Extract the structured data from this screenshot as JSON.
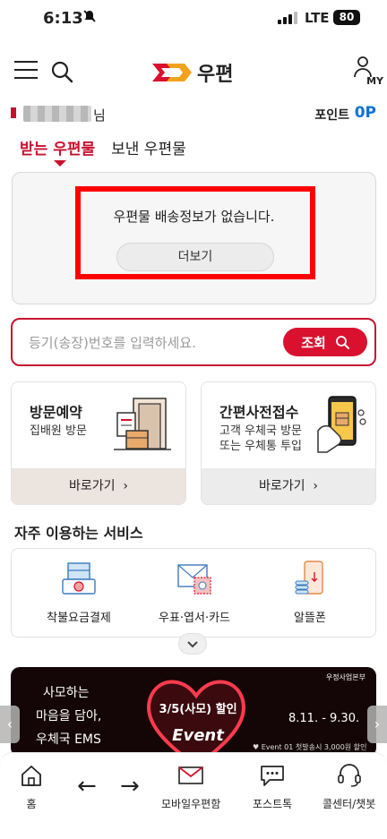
{
  "status_bar": {
    "time": "6:13",
    "network": "LTE",
    "battery": "80"
  },
  "header": {
    "logo_text": "우편",
    "my_label": "MY"
  },
  "user": {
    "name_suffix": "님",
    "point_label": "포인트",
    "point_value": "0P"
  },
  "tabs": [
    {
      "label": "받는 우편물",
      "active": true
    },
    {
      "label": "보낸 우편물",
      "active": false
    }
  ],
  "delivery": {
    "empty_text": "우편물 배송정보가 없습니다.",
    "more_label": "더보기"
  },
  "search": {
    "placeholder": "등기(송장)번호를 입력하세요.",
    "button_label": "조회"
  },
  "service_cards": [
    {
      "title": "방문예약",
      "desc": [
        "집배원 방문"
      ],
      "go_label": "바로가기",
      "go_arrow": "›"
    },
    {
      "title": "간편사전접수",
      "desc": [
        "고객 우체국 방문",
        "또는 우체통 투입"
      ],
      "go_label": "바로가기",
      "go_arrow": "›"
    }
  ],
  "frequent": {
    "title": "자주 이용하는 서비스",
    "items": [
      {
        "label": "착불요금결제",
        "icon": "cod-payment-icon"
      },
      {
        "label": "우표·엽서·카드",
        "icon": "stamp-postcard-icon"
      },
      {
        "label": "알뜰폰",
        "icon": "budget-phone-icon"
      }
    ]
  },
  "banner": {
    "line1": "사모하는",
    "line2": "마음을 담아,",
    "line3": "우체국 EMS",
    "promo": "3/5(사모) 할인",
    "event": "Event",
    "period": "8.11. - 9.30.",
    "org": "우정사업본부",
    "fine_print": "♥ Event 01 첫발송시 3,000원 할인"
  },
  "bottom_nav": {
    "home": "홈",
    "back_arrow": "←",
    "forward_arrow": "→",
    "mailbox": "모바일우편함",
    "posttalk": "포스트톡",
    "callcenter": "콜센터/챗봇"
  },
  "colors": {
    "brand_red": "#c8102e",
    "point_blue": "#0a72d6",
    "highlight": "#ff0000"
  }
}
